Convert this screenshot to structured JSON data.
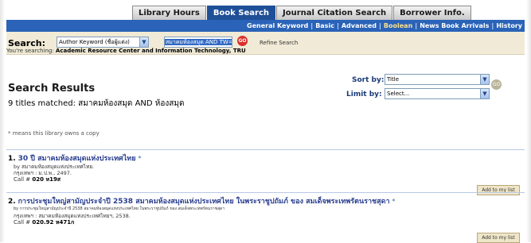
{
  "tabs": [
    {
      "label": "Library Hours",
      "active": false
    },
    {
      "label": "Book Search",
      "active": true
    },
    {
      "label": "Journal Citation Search",
      "active": false
    },
    {
      "label": "Borrower Info.",
      "active": false
    }
  ],
  "subnav": {
    "items": [
      "General Keyword",
      "Basic",
      "Advanced",
      "Boolean",
      "News Book Arrivals",
      "History"
    ],
    "selected": "Boolean",
    "separator": "|"
  },
  "search": {
    "label": "Search:",
    "type_value": "Author Keyword (ชื่อผู้แต่ง)",
    "query_value": "สมาคมห้องสมุด AND TW=ห้องส",
    "go_label": "GO",
    "refine_label": "Refine Search",
    "searching_prefix": "You're searching:",
    "searching_target": "Academic Resource Center and Information Technology, TRU"
  },
  "results": {
    "title": "Search Results",
    "matched": "9 titles matched: สมาคมห้องสมุด AND ห้องสมุด",
    "sort_label": "Sort by:",
    "sort_value": "Title",
    "limit_label": "Limit by:",
    "limit_value": "Select...",
    "go_label": "GO",
    "owns_note": "* means this library owns a copy"
  },
  "records": [
    {
      "num": "1.",
      "title": "30 ปี สมาคมห้องสมุดแห่งประเทศไทย",
      "star": "*",
      "by": "by สมาคมห้องสมุดแห่งประเทศไทย.",
      "pub": "กรุงเทพฯ : ม.ป.พ., 2497.",
      "call_label": "Call #",
      "call": "020 ห19ส",
      "add_label": "Add to my list"
    },
    {
      "num": "2.",
      "title": "การประชุมใหญ่สามัญประจำปี 2538 สมาคมห้องสมุดแห่งประเทศไทย ในพระราชูปถัมภ์ ของ สมเด็จพระเทพรัตนราชสุดา",
      "star": "*",
      "by": "by การประชุมใหญ่สามัญประจำปี 2538 สมาคมห้องสมุดแห่งประเทศไทย ในพระราชูปถัมภ์ ของ สมเด็จพระเทพรัตนราชสุดา",
      "pub": "กรุงเทพฯ : สมาคมห้องสมุดแห่งประเทศไทยฯ, 2538.",
      "call_label": "Call #",
      "call": "020.92 ห471ก",
      "add_label": "Add to my list"
    }
  ],
  "colors": {
    "nav_blue": "#2a63b8",
    "active_tab": "#1f4f97",
    "search_bg": "#f1ead6",
    "title_link": "#2a3f8f"
  }
}
